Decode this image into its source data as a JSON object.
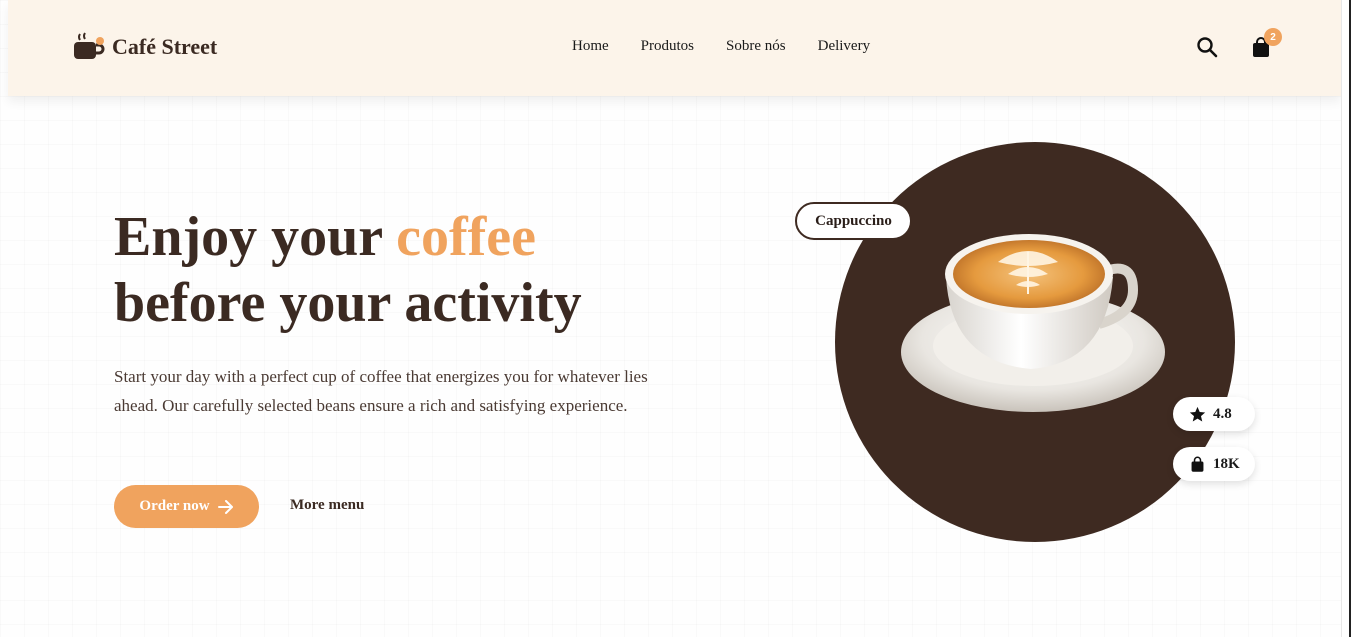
{
  "brand": {
    "name": "Café Street"
  },
  "nav": {
    "items": [
      {
        "label": "Home"
      },
      {
        "label": "Produtos"
      },
      {
        "label": "Sobre nós"
      },
      {
        "label": "Delivery"
      }
    ]
  },
  "header": {
    "search_icon": "search-icon",
    "cart_icon": "shopping-bag-icon",
    "cart_count": "2"
  },
  "hero": {
    "title_part1": "Enjoy your ",
    "title_accent": "coffee",
    "title_part2": "before your activity",
    "description": "Start your day with a perfect cup of coffee that energizes you for whatever lies ahead. Our carefully selected beans ensure a rich and satisfying experience.",
    "order_label": "Order now",
    "more_label": "More menu"
  },
  "product": {
    "tag": "Cappuccino",
    "rating": "4.8",
    "sold": "18K"
  },
  "colors": {
    "accent": "#f0a35e",
    "brown": "#3e2a21",
    "header_bg": "#fcf4ea"
  }
}
